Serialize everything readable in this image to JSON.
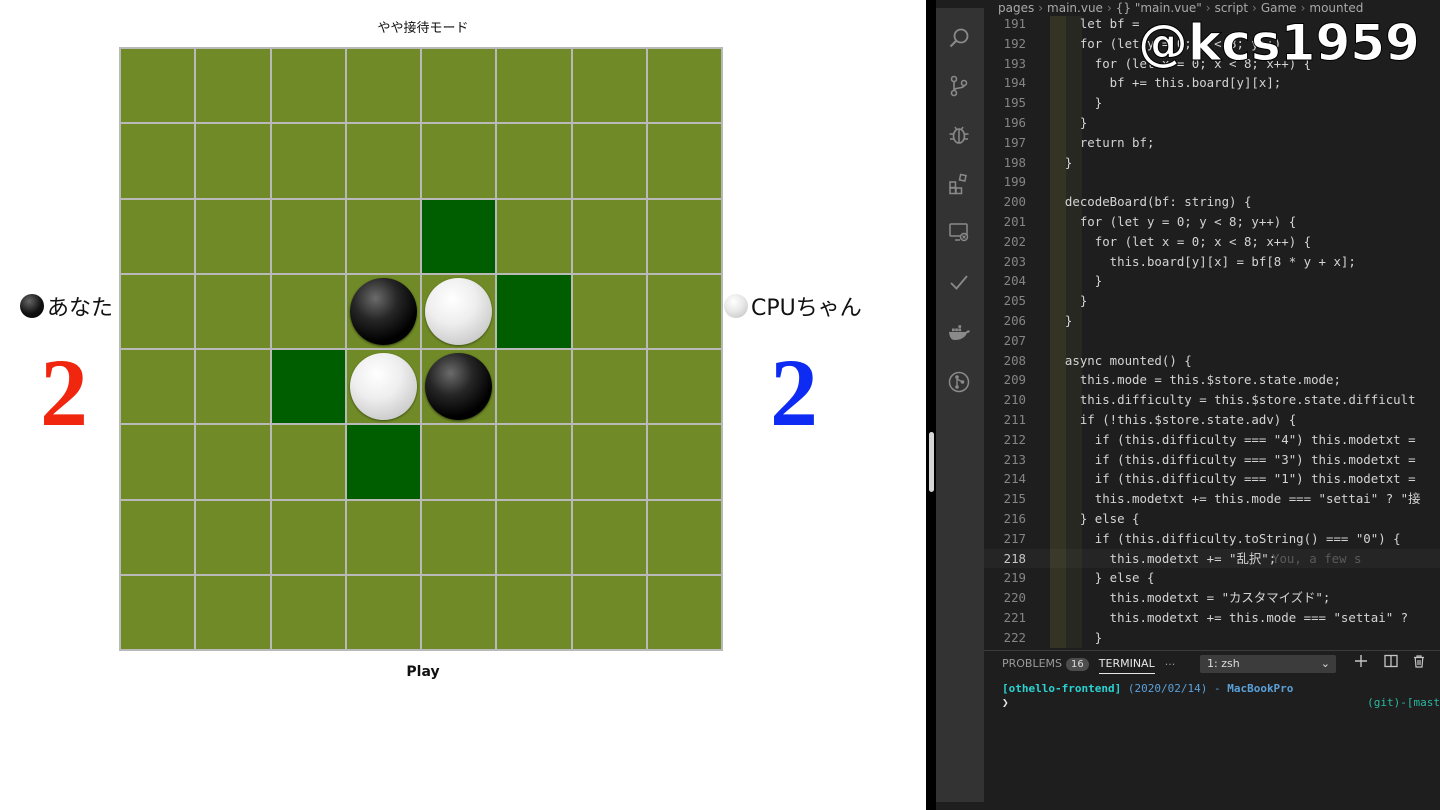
{
  "game": {
    "mode_title": "やや接待モード",
    "play_label": "Play",
    "you": {
      "name": "あなた",
      "score": "2",
      "score_color": "#f0260e",
      "disc": "black"
    },
    "cpu": {
      "name": "CPUちゃん",
      "score": "2",
      "score_color": "#0d2bf2",
      "disc": "white"
    },
    "board": [
      [
        "",
        "",
        "",
        "",
        "",
        "",
        "",
        ""
      ],
      [
        "",
        "",
        "",
        "",
        "",
        "",
        "",
        ""
      ],
      [
        "",
        "",
        "",
        "",
        "hint",
        "",
        "",
        ""
      ],
      [
        "",
        "",
        "",
        "black",
        "white",
        "hint",
        "",
        ""
      ],
      [
        "",
        "",
        "hint",
        "white",
        "black",
        "",
        "",
        ""
      ],
      [
        "",
        "",
        "",
        "hint",
        "",
        "",
        "",
        ""
      ],
      [
        "",
        "",
        "",
        "",
        "",
        "",
        "",
        ""
      ],
      [
        "",
        "",
        "",
        "",
        "",
        "",
        "",
        ""
      ]
    ],
    "colors": {
      "board": "#6f8a26",
      "hint": "#005e00"
    }
  },
  "editor": {
    "breadcrumb": [
      "pages",
      "main.vue",
      "{} \"main.vue\"",
      "script",
      "Game",
      "mounted"
    ],
    "watermark": "@kcs1959",
    "activity_icons": [
      "search-icon",
      "source-control-icon",
      "debug-icon",
      "extensions-icon",
      "remote-explorer-icon",
      "check-icon",
      "docker-icon",
      "git-graph-icon"
    ],
    "lines": [
      {
        "n": "191",
        "text": "    let bf = "
      },
      {
        "n": "192",
        "text": "    for (let y = 0; y < 8; y++)"
      },
      {
        "n": "193",
        "text": "      for (let x = 0; x < 8; x++) {"
      },
      {
        "n": "194",
        "text": "        bf += this.board[y][x];"
      },
      {
        "n": "195",
        "text": "      }"
      },
      {
        "n": "196",
        "text": "    }"
      },
      {
        "n": "197",
        "text": "    return bf;"
      },
      {
        "n": "198",
        "text": "  }"
      },
      {
        "n": "199",
        "text": ""
      },
      {
        "n": "200",
        "text": "  decodeBoard(bf: string) {"
      },
      {
        "n": "201",
        "text": "    for (let y = 0; y < 8; y++) {"
      },
      {
        "n": "202",
        "text": "      for (let x = 0; x < 8; x++) {"
      },
      {
        "n": "203",
        "text": "        this.board[y][x] = bf[8 * y + x];"
      },
      {
        "n": "204",
        "text": "      }"
      },
      {
        "n": "205",
        "text": "    }"
      },
      {
        "n": "206",
        "text": "  }"
      },
      {
        "n": "207",
        "text": ""
      },
      {
        "n": "208",
        "text": "  async mounted() {"
      },
      {
        "n": "209",
        "text": "    this.mode = this.$store.state.mode;"
      },
      {
        "n": "210",
        "text": "    this.difficulty = this.$store.state.difficult"
      },
      {
        "n": "211",
        "text": "    if (!this.$store.state.adv) {"
      },
      {
        "n": "212",
        "text": "      if (this.difficulty === \"4\") this.modetxt ="
      },
      {
        "n": "213",
        "text": "      if (this.difficulty === \"3\") this.modetxt ="
      },
      {
        "n": "214",
        "text": "      if (this.difficulty === \"1\") this.modetxt ="
      },
      {
        "n": "215",
        "text": "      this.modetxt += this.mode === \"settai\" ? \"接"
      },
      {
        "n": "216",
        "text": "    } else {"
      },
      {
        "n": "217",
        "text": "      if (this.difficulty.toString() === \"0\") {"
      },
      {
        "n": "218",
        "text": "        this.modetxt += \"乱択\";",
        "blame": "You, a few s"
      },
      {
        "n": "219",
        "text": "      } else {"
      },
      {
        "n": "220",
        "text": "        this.modetxt = \"カスタマイズド\";"
      },
      {
        "n": "221",
        "text": "        this.modetxt += this.mode === \"settai\" ?"
      },
      {
        "n": "222",
        "text": "      }"
      }
    ],
    "panel": {
      "problems_label": "PROBLEMS",
      "problems_count": "16",
      "terminal_label": "TERMINAL",
      "more_label": "···",
      "terminal_select": "1: zsh",
      "term_project": "[othello-frontend]",
      "term_date": "(2020/02/14)",
      "term_dash": " - ",
      "term_host": "MacBookPro",
      "term_git": "(git)-[mast",
      "term_prompt": "❯"
    }
  }
}
